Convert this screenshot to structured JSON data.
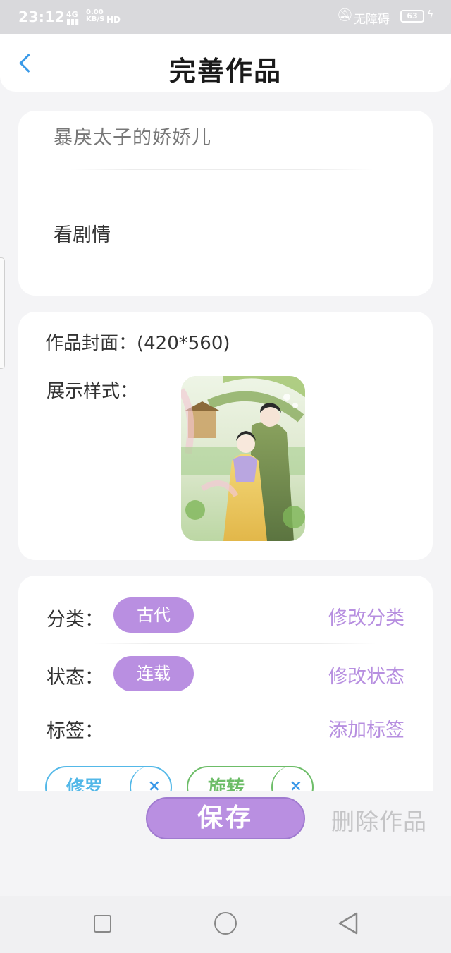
{
  "status_bar": {
    "time": "23:12",
    "network": "4G",
    "speed_value": "0.00",
    "speed_unit": "KB/S",
    "hd": "HD",
    "accessibility": "无障碍",
    "battery": "63",
    "icons": [
      "signal-icon",
      "wifi-icon",
      "mute-icon",
      "battery-icon",
      "charging-icon"
    ]
  },
  "header": {
    "title": "完善作品",
    "back_icon": "chevron-left-icon",
    "accent_color": "#3a9ae8"
  },
  "work_info": {
    "title": "暴戾太子的娇娇儿",
    "synopsis": "看剧情"
  },
  "cover": {
    "label": "作品封面：(420*560)",
    "display_label": "展示样式："
  },
  "meta": {
    "category_label": "分类：",
    "category_value": "古代",
    "category_action": "修改分类",
    "status_label": "状态：",
    "status_value": "连载",
    "status_action": "修改状态",
    "tags_label": "标签：",
    "tags_action": "添加标签",
    "tags": [
      {
        "text": "修罗",
        "color": "#53b8e8"
      },
      {
        "text": "旋转",
        "color": "#6dbd68"
      }
    ],
    "tag_remove_symbol": "×",
    "accent_color": "#b98fe1"
  },
  "footer": {
    "save_label": "保存",
    "delete_label": "删除作品"
  },
  "system_nav": {
    "icons": [
      "recent-apps-icon",
      "home-icon",
      "back-triangle-icon"
    ]
  }
}
